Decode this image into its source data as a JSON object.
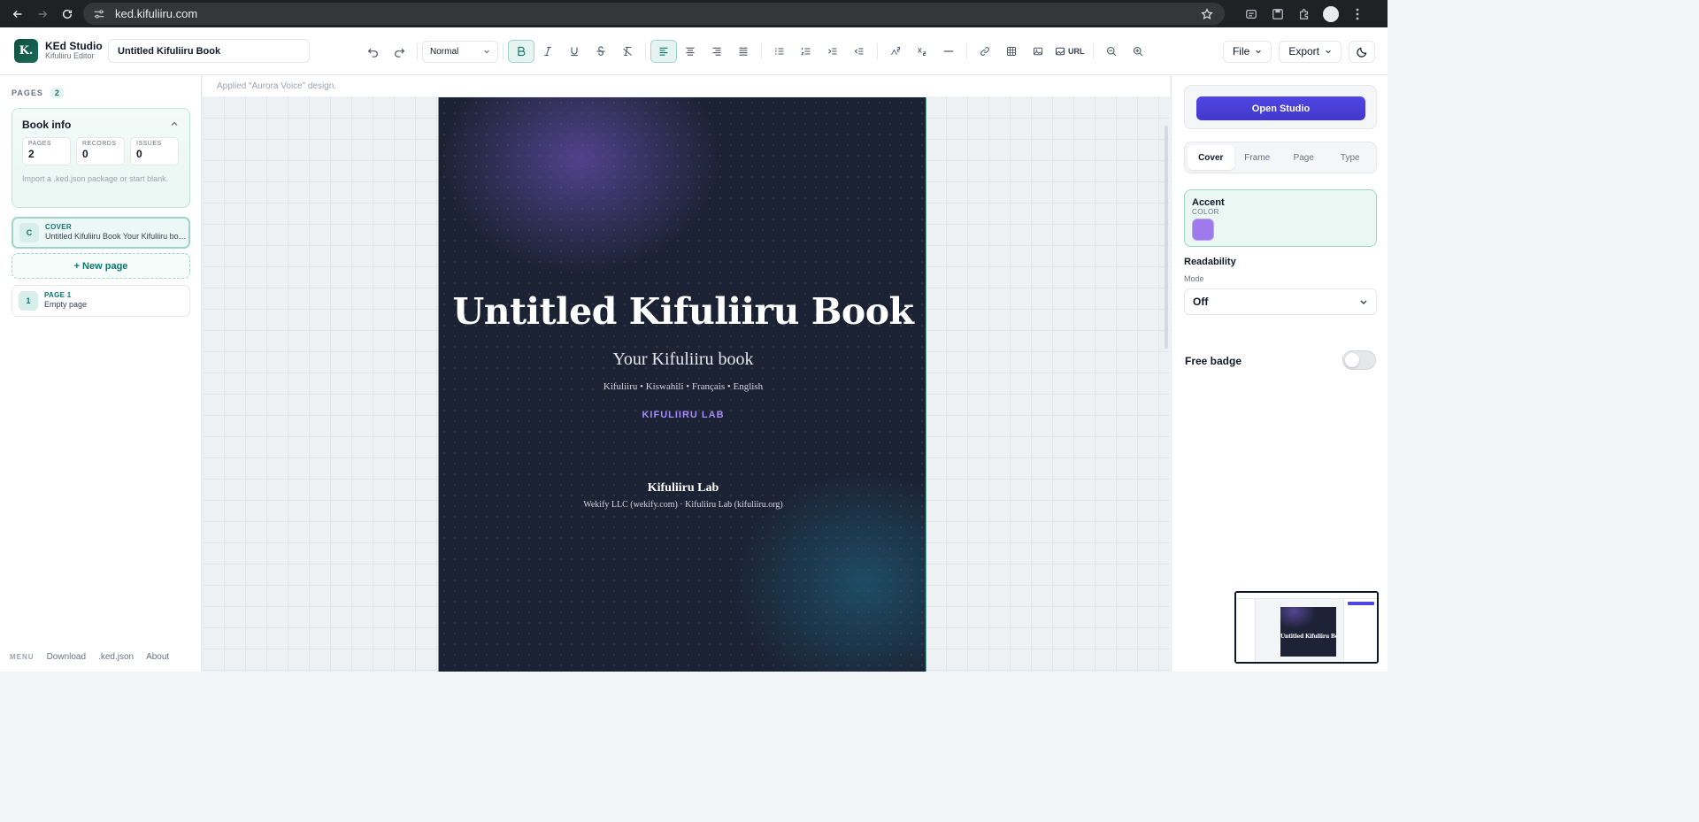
{
  "browser": {
    "url": "ked.kifuliiru.com"
  },
  "app": {
    "name": "KEd Studio",
    "subtitle": "Kifuliiru Editor",
    "logo_letter": "K.",
    "document_title": "Untitled Kifuliiru Book"
  },
  "toolbar": {
    "style_select": "Normal",
    "url_label": "URL",
    "file_label": "File",
    "export_label": "Export",
    "icons": [
      "undo-icon",
      "redo-icon",
      "bold-icon",
      "italic-icon",
      "underline-icon",
      "strikethrough-icon",
      "clear-format-icon",
      "align-left-icon",
      "align-center-icon",
      "align-right-icon",
      "align-justify-icon",
      "bullet-list-icon",
      "numbered-list-icon",
      "indent-icon",
      "outdent-icon",
      "superscript-icon",
      "subscript-icon",
      "horizontal-rule-icon",
      "link-icon",
      "table-icon",
      "image-icon",
      "zoom-out-icon",
      "zoom-in-icon",
      "dark-mode-icon"
    ]
  },
  "sidebar": {
    "pages_label": "PAGES",
    "pages_count": "2",
    "book_info": {
      "title": "Book info",
      "stats": [
        {
          "label": "PAGES",
          "value": "2"
        },
        {
          "label": "RECORDS",
          "value": "0"
        },
        {
          "label": "ISSUES",
          "value": "0"
        }
      ],
      "hint": "Import a .ked.json package or start blank."
    },
    "cover_card": {
      "badge": "C",
      "kind": "COVER",
      "summary": "Untitled Kifuliiru Book Your Kifuliiru book"
    },
    "new_page": "+ New page",
    "page_cards": [
      {
        "badge": "1",
        "kind": "PAGE 1",
        "summary": "Empty page"
      }
    ],
    "menu": {
      "label": "MENU",
      "items": [
        "Download",
        ".ked.json",
        "About"
      ]
    }
  },
  "canvas": {
    "status": "Applied “Aurora Voice” design.",
    "cover": {
      "title": "Untitled Kifuliiru Book",
      "subtitle": "Your Kifuliiru book",
      "languages": "Kifuliiru • Kiswahili • Français • English",
      "lab": "KIFULIIRU LAB",
      "publisher": "Kifuliiru Lab",
      "publisher_sub": "Wekify LLC (wekify.com) · Kifuliiru Lab (kifuliiru.org)"
    }
  },
  "right_panel": {
    "open_studio": "Open Studio",
    "tabs": [
      "Cover",
      "Frame",
      "Page",
      "Type"
    ],
    "active_tab": "Cover",
    "accent_label": "Accent",
    "accent_sub": "COLOR",
    "accent_color": "#9f7aea",
    "readability_label": "Readability",
    "mode_label": "Mode",
    "mode_value": "Off",
    "free_badge_label": "Free badge",
    "free_badge_on": false,
    "thumbnail_title": "Untitled Kifuliiru Book"
  }
}
